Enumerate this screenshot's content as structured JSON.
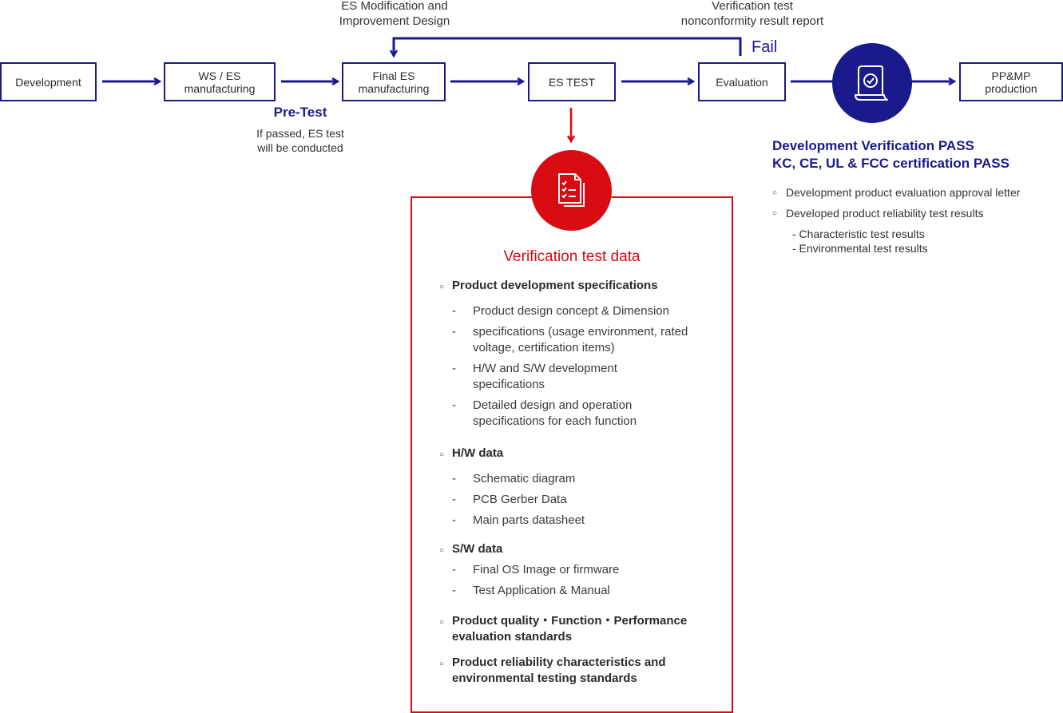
{
  "colors": {
    "primary_blue": "#1a1a8c",
    "accent_red": "#d80a12",
    "text": "#333333"
  },
  "flow": {
    "steps": [
      {
        "id": "development",
        "label": "Development"
      },
      {
        "id": "ws-es-manufacturing",
        "label": "WS / ES\nmanufacturing"
      },
      {
        "id": "final-es-manufacturing",
        "label": "Final ES\nmanufacturing"
      },
      {
        "id": "es-test",
        "label": "ES TEST"
      },
      {
        "id": "evaluation",
        "label": "Evaluation"
      },
      {
        "id": "pp-mp-production",
        "label": "PP&MP\nproduction"
      }
    ],
    "loop": {
      "left_caption": "ES Modification and\nImprovement Design",
      "right_caption": "Verification test\nnonconformity result report",
      "fail_label": "Fail"
    },
    "pretest": {
      "title": "Pre-Test",
      "caption": "If passed, ES test\nwill be conducted"
    },
    "pass_icon": "certificate-check-icon",
    "data_icon": "checklist-document-icon"
  },
  "pass_info": {
    "title_line1": "Development Verification PASS",
    "title_line2": "KC, CE, UL & FCC certification PASS",
    "items": [
      {
        "text": "Development product evaluation approval letter",
        "subitems": []
      },
      {
        "text": "Developed product reliability test results",
        "subitems": [
          "- Characteristic test results",
          "- Environmental test results"
        ]
      }
    ]
  },
  "verification": {
    "title": "Verification test data",
    "sections": [
      {
        "heading": "Product development specifications",
        "items": [
          "Product design concept & Dimension",
          "specifications  (usage environment, rated voltage, certification items)",
          "H/W and S/W development specifications",
          "Detailed design and operation specifications for each function"
        ]
      },
      {
        "heading": "H/W data",
        "items": [
          "Schematic diagram",
          "PCB Gerber Data",
          "Main parts datasheet"
        ]
      },
      {
        "heading": "S/W data",
        "items": [
          "Final OS Image or firmware",
          "Test Application & Manual"
        ]
      },
      {
        "heading": "Product quality・Function・Performance evaluation standards",
        "items": []
      },
      {
        "heading": "Product reliability characteristics and environmental testing standards",
        "items": []
      }
    ]
  }
}
